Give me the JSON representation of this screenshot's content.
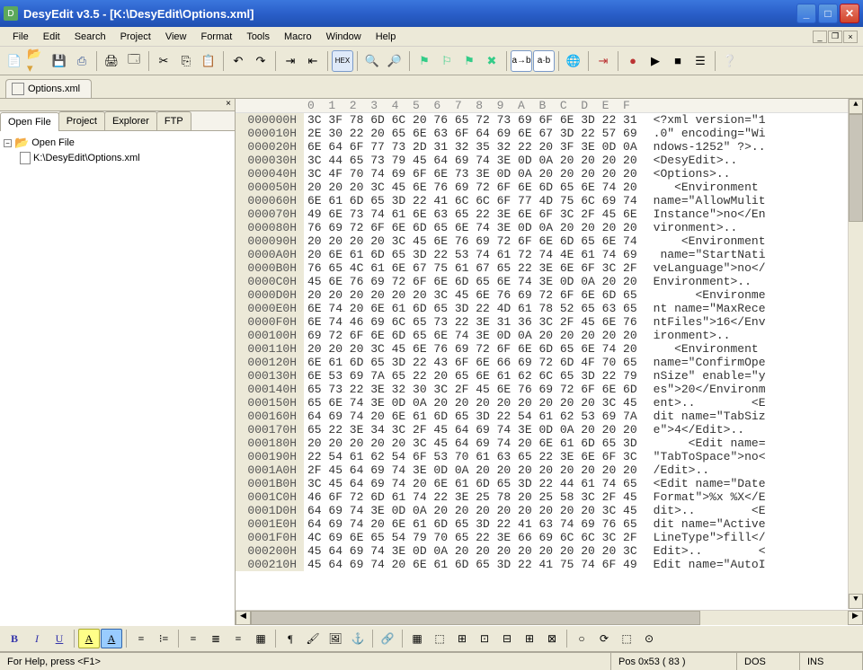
{
  "title": "DesyEdit v3.5 - [K:\\DesyEdit\\Options.xml]",
  "menu": [
    "File",
    "Edit",
    "Search",
    "Project",
    "View",
    "Format",
    "Tools",
    "Macro",
    "Window",
    "Help"
  ],
  "file_tab": "Options.xml",
  "sidebar": {
    "tabs": [
      "Open File",
      "Project",
      "Explorer",
      "FTP"
    ],
    "root": "Open File",
    "file": "K:\\DesyEdit\\Options.xml"
  },
  "hex": {
    "ruler": "0  1  2  3  4  5  6  7  8  9  A  B  C  D  E  F",
    "rows": [
      {
        "o": "000000H",
        "b": "3C 3F 78 6D 6C 20 76 65 72 73 69 6F 6E 3D 22 31",
        "a": "<?xml version=\"1"
      },
      {
        "o": "000010H",
        "b": "2E 30 22 20 65 6E 63 6F 64 69 6E 67 3D 22 57 69",
        "a": ".0\" encoding=\"Wi"
      },
      {
        "o": "000020H",
        "b": "6E 64 6F 77 73 2D 31 32 35 32 22 20 3F 3E 0D 0A",
        "a": "ndows-1252\" ?>.."
      },
      {
        "o": "000030H",
        "b": "3C 44 65 73 79 45 64 69 74 3E 0D 0A 20 20 20 20",
        "a": "<DesyEdit>..    "
      },
      {
        "o": "000040H",
        "b": "3C 4F 70 74 69 6F 6E 73 3E 0D 0A 20 20 20 20 20",
        "a": "<Options>..     "
      },
      {
        "o": "000050H",
        "b": "20 20 20 3C 45 6E 76 69 72 6F 6E 6D 65 6E 74 20",
        "a": "   <Environment "
      },
      {
        "o": "000060H",
        "b": "6E 61 6D 65 3D 22 41 6C 6C 6F 77 4D 75 6C 69 74",
        "a": "name=\"AllowMulit"
      },
      {
        "o": "000070H",
        "b": "49 6E 73 74 61 6E 63 65 22 3E 6E 6F 3C 2F 45 6E",
        "a": "Instance\">no</En"
      },
      {
        "o": "000080H",
        "b": "76 69 72 6F 6E 6D 65 6E 74 3E 0D 0A 20 20 20 20",
        "a": "vironment>..    "
      },
      {
        "o": "000090H",
        "b": "20 20 20 20 3C 45 6E 76 69 72 6F 6E 6D 65 6E 74",
        "a": "    <Environment"
      },
      {
        "o": "0000A0H",
        "b": "20 6E 61 6D 65 3D 22 53 74 61 72 74 4E 61 74 69",
        "a": " name=\"StartNati"
      },
      {
        "o": "0000B0H",
        "b": "76 65 4C 61 6E 67 75 61 67 65 22 3E 6E 6F 3C 2F",
        "a": "veLanguage\">no</"
      },
      {
        "o": "0000C0H",
        "b": "45 6E 76 69 72 6F 6E 6D 65 6E 74 3E 0D 0A 20 20",
        "a": "Environment>..  "
      },
      {
        "o": "0000D0H",
        "b": "20 20 20 20 20 20 3C 45 6E 76 69 72 6F 6E 6D 65",
        "a": "      <Environme"
      },
      {
        "o": "0000E0H",
        "b": "6E 74 20 6E 61 6D 65 3D 22 4D 61 78 52 65 63 65",
        "a": "nt name=\"MaxRece"
      },
      {
        "o": "0000F0H",
        "b": "6E 74 46 69 6C 65 73 22 3E 31 36 3C 2F 45 6E 76",
        "a": "ntFiles\">16</Env"
      },
      {
        "o": "000100H",
        "b": "69 72 6F 6E 6D 65 6E 74 3E 0D 0A 20 20 20 20 20",
        "a": "ironment>..     "
      },
      {
        "o": "000110H",
        "b": "20 20 20 3C 45 6E 76 69 72 6F 6E 6D 65 6E 74 20",
        "a": "   <Environment "
      },
      {
        "o": "000120H",
        "b": "6E 61 6D 65 3D 22 43 6F 6E 66 69 72 6D 4F 70 65",
        "a": "name=\"ConfirmOpe"
      },
      {
        "o": "000130H",
        "b": "6E 53 69 7A 65 22 20 65 6E 61 62 6C 65 3D 22 79",
        "a": "nSize\" enable=\"y"
      },
      {
        "o": "000140H",
        "b": "65 73 22 3E 32 30 3C 2F 45 6E 76 69 72 6F 6E 6D",
        "a": "es\">20</Environm"
      },
      {
        "o": "000150H",
        "b": "65 6E 74 3E 0D 0A 20 20 20 20 20 20 20 20 3C 45",
        "a": "ent>..        <E"
      },
      {
        "o": "000160H",
        "b": "64 69 74 20 6E 61 6D 65 3D 22 54 61 62 53 69 7A",
        "a": "dit name=\"TabSiz"
      },
      {
        "o": "000170H",
        "b": "65 22 3E 34 3C 2F 45 64 69 74 3E 0D 0A 20 20 20",
        "a": "e\">4</Edit>..   "
      },
      {
        "o": "000180H",
        "b": "20 20 20 20 20 3C 45 64 69 74 20 6E 61 6D 65 3D",
        "a": "     <Edit name="
      },
      {
        "o": "000190H",
        "b": "22 54 61 62 54 6F 53 70 61 63 65 22 3E 6E 6F 3C",
        "a": "\"TabToSpace\">no<"
      },
      {
        "o": "0001A0H",
        "b": "2F 45 64 69 74 3E 0D 0A 20 20 20 20 20 20 20 20",
        "a": "/Edit>..        "
      },
      {
        "o": "0001B0H",
        "b": "3C 45 64 69 74 20 6E 61 6D 65 3D 22 44 61 74 65",
        "a": "<Edit name=\"Date"
      },
      {
        "o": "0001C0H",
        "b": "46 6F 72 6D 61 74 22 3E 25 78 20 25 58 3C 2F 45",
        "a": "Format\">%x %X</E"
      },
      {
        "o": "0001D0H",
        "b": "64 69 74 3E 0D 0A 20 20 20 20 20 20 20 20 3C 45",
        "a": "dit>..        <E"
      },
      {
        "o": "0001E0H",
        "b": "64 69 74 20 6E 61 6D 65 3D 22 41 63 74 69 76 65",
        "a": "dit name=\"Active"
      },
      {
        "o": "0001F0H",
        "b": "4C 69 6E 65 54 79 70 65 22 3E 66 69 6C 6C 3C 2F",
        "a": "LineType\">fill</"
      },
      {
        "o": "000200H",
        "b": "45 64 69 74 3E 0D 0A 20 20 20 20 20 20 20 20 3C",
        "a": "Edit>..        <"
      },
      {
        "o": "000210H",
        "b": "45 64 69 74 20 6E 61 6D 65 3D 22 41 75 74 6F 49",
        "a": "Edit name=\"AutoI"
      }
    ]
  },
  "status": {
    "help": "For Help, press <F1>",
    "pos": "Pos 0x53 ( 83 )",
    "enc": "DOS",
    "ins": "INS"
  }
}
